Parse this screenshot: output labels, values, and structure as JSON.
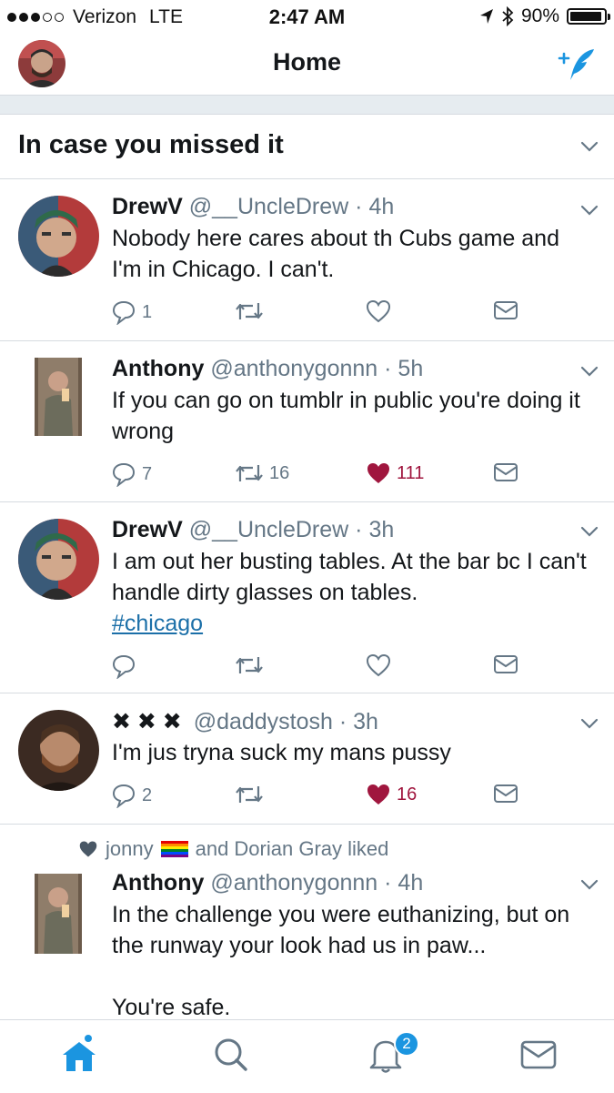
{
  "status_bar": {
    "carrier": "Verizon",
    "network": "LTE",
    "time": "2:47 AM",
    "battery": "90%"
  },
  "nav": {
    "title": "Home"
  },
  "section": {
    "title": "In case you missed it"
  },
  "tweets": [
    {
      "name": "DrewV",
      "handle": "@__UncleDrew",
      "time": "4h",
      "text": "Nobody here cares about th Cubs game and I'm in Chicago. I can't.",
      "replies": "1",
      "retweets": "",
      "likes": "",
      "liked": false
    },
    {
      "name": "Anthony",
      "handle": "@anthonygonnn",
      "time": "5h",
      "text": "If you can go on tumblr in public you're doing it wrong",
      "replies": "7",
      "retweets": "16",
      "likes": "111",
      "liked": true
    },
    {
      "name": "DrewV",
      "handle": "@__UncleDrew",
      "time": "3h",
      "text": "I am out her busting tables. At the bar bc I can't handle dirty glasses on tables.",
      "hashtag": "#chicago",
      "replies": "",
      "retweets": "",
      "likes": "",
      "liked": false
    },
    {
      "name": "✖ ✖ ✖",
      "handle": "@daddystosh",
      "time": "3h",
      "text": "I'm jus tryna suck my mans pussy",
      "replies": "2",
      "retweets": "",
      "likes": "16",
      "liked": true
    },
    {
      "social_user": "jonny",
      "social_rest": "and Dorian Gray liked",
      "name": "Anthony",
      "handle": "@anthonygonnn",
      "time": "4h",
      "text": "In the challenge you were euthanizing, but on the runway your look had us in paw...",
      "text2": "You're safe."
    }
  ],
  "tabbar": {
    "notifications_badge": "2"
  },
  "colors": {
    "accent": "#1b95e0",
    "liked": "#a0163e",
    "link": "#1b6fa8",
    "muted": "#657786"
  }
}
